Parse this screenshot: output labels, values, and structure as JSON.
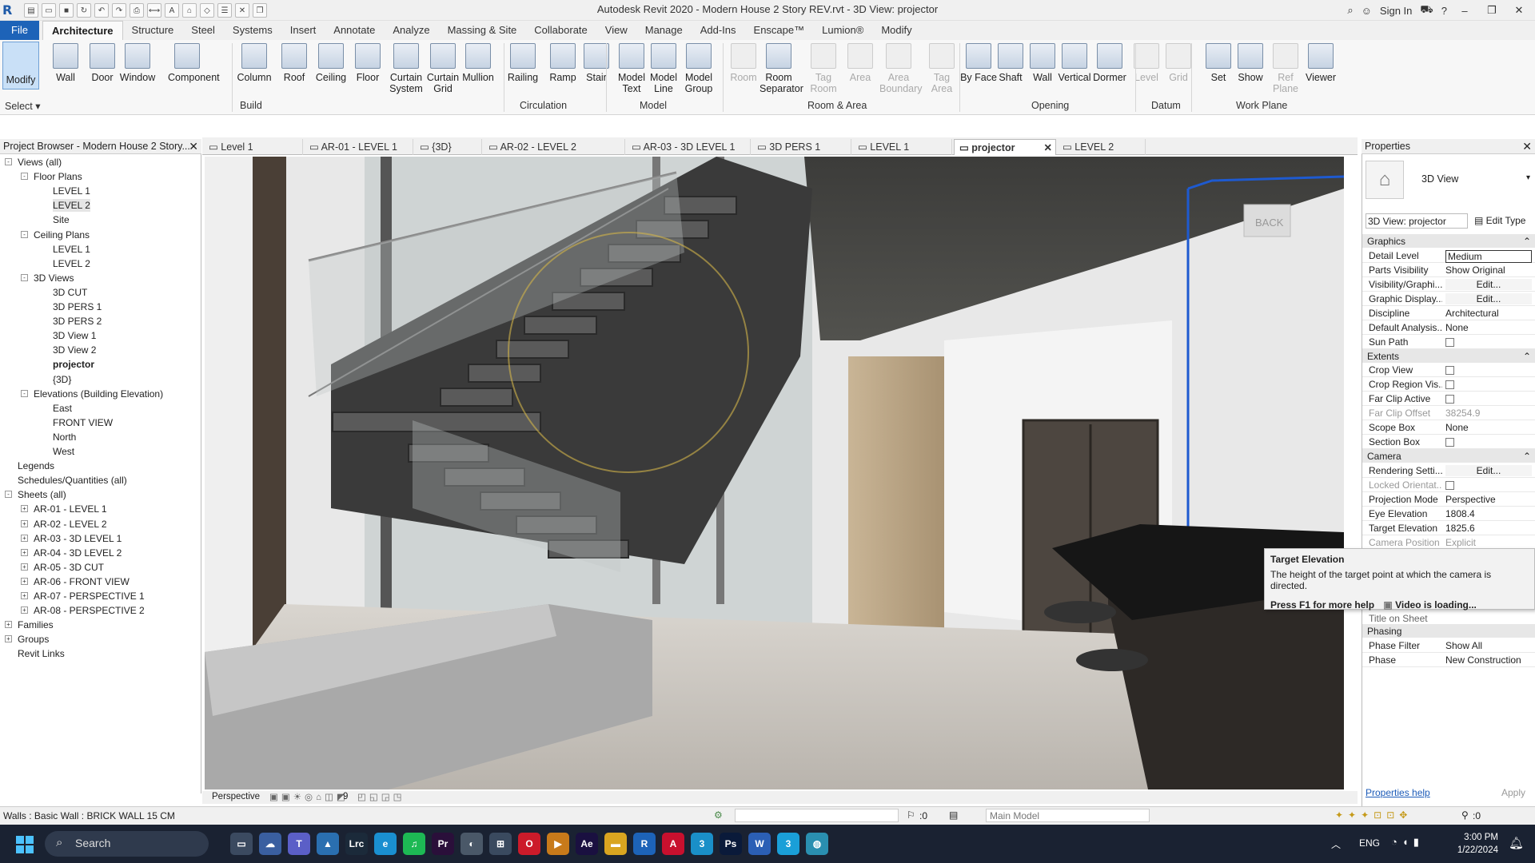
{
  "titlebar": {
    "title": "Autodesk Revit 2020 - Modern House 2 Story REV.rvt - 3D View: projector",
    "sign_in": "Sign In"
  },
  "ribbon_tabs": [
    "File",
    "Architecture",
    "Structure",
    "Steel",
    "Systems",
    "Insert",
    "Annotate",
    "Analyze",
    "Massing & Site",
    "Collaborate",
    "View",
    "Manage",
    "Add-Ins",
    "Enscape™",
    "Lumion®",
    "Modify"
  ],
  "active_tab": "Architecture",
  "ribbon": {
    "select_label": "Select",
    "modify": "Modify",
    "buttons": [
      {
        "label": "Wall",
        "disabled": false
      },
      {
        "label": "Door",
        "disabled": false
      },
      {
        "label": "Window",
        "disabled": false
      },
      {
        "label": "Component",
        "disabled": false
      },
      {
        "label": "Column",
        "disabled": false
      },
      {
        "label": "Roof",
        "disabled": false
      },
      {
        "label": "Ceiling",
        "disabled": false
      },
      {
        "label": "Floor",
        "disabled": false
      },
      {
        "label": "Curtain System",
        "disabled": false
      },
      {
        "label": "Curtain Grid",
        "disabled": false
      },
      {
        "label": "Mullion",
        "disabled": false
      },
      {
        "label": "Railing",
        "disabled": false
      },
      {
        "label": "Ramp",
        "disabled": false
      },
      {
        "label": "Stair",
        "disabled": false
      },
      {
        "label": "Model Text",
        "disabled": false
      },
      {
        "label": "Model Line",
        "disabled": false
      },
      {
        "label": "Model Group",
        "disabled": false
      },
      {
        "label": "Room",
        "disabled": true
      },
      {
        "label": "Room Separator",
        "disabled": false
      },
      {
        "label": "Tag Room",
        "disabled": true
      },
      {
        "label": "Area",
        "disabled": true
      },
      {
        "label": "Area Boundary",
        "disabled": true
      },
      {
        "label": "Tag Area",
        "disabled": true
      },
      {
        "label": "By Face",
        "disabled": false
      },
      {
        "label": "Shaft",
        "disabled": false
      },
      {
        "label": "Wall",
        "disabled": false
      },
      {
        "label": "Vertical",
        "disabled": false
      },
      {
        "label": "Dormer",
        "disabled": false
      },
      {
        "label": "Level",
        "disabled": true
      },
      {
        "label": "Grid",
        "disabled": true
      },
      {
        "label": "Set",
        "disabled": false
      },
      {
        "label": "Show",
        "disabled": false
      },
      {
        "label": "Ref Plane",
        "disabled": true
      },
      {
        "label": "Viewer",
        "disabled": false
      }
    ],
    "panels": [
      "Build",
      "Circulation",
      "Model",
      "Room & Area",
      "Opening",
      "Datum",
      "Work Plane"
    ]
  },
  "project_browser": {
    "title": "Project Browser - Modern House 2 Story...",
    "items": [
      {
        "label": "Views (all)",
        "level": 0,
        "toggle": "-"
      },
      {
        "label": "Floor Plans",
        "level": 1,
        "toggle": "-"
      },
      {
        "label": "LEVEL 1",
        "level": 2
      },
      {
        "label": "LEVEL 2",
        "level": 2,
        "highlight": true
      },
      {
        "label": "Site",
        "level": 2
      },
      {
        "label": "Ceiling Plans",
        "level": 1,
        "toggle": "-"
      },
      {
        "label": "LEVEL 1",
        "level": 2
      },
      {
        "label": "LEVEL 2",
        "level": 2
      },
      {
        "label": "3D Views",
        "level": 1,
        "toggle": "-"
      },
      {
        "label": "3D CUT",
        "level": 2
      },
      {
        "label": "3D PERS 1",
        "level": 2
      },
      {
        "label": "3D PERS 2",
        "level": 2
      },
      {
        "label": "3D View 1",
        "level": 2
      },
      {
        "label": "3D View 2",
        "level": 2
      },
      {
        "label": "projector",
        "level": 2,
        "bold": true
      },
      {
        "label": "{3D}",
        "level": 2
      },
      {
        "label": "Elevations (Building Elevation)",
        "level": 1,
        "toggle": "-"
      },
      {
        "label": "East",
        "level": 2
      },
      {
        "label": "FRONT VIEW",
        "level": 2
      },
      {
        "label": "North",
        "level": 2
      },
      {
        "label": "West",
        "level": 2
      },
      {
        "label": "Legends",
        "level": 0
      },
      {
        "label": "Schedules/Quantities (all)",
        "level": 0
      },
      {
        "label": "Sheets (all)",
        "level": 0,
        "toggle": "-"
      },
      {
        "label": "AR-01 - LEVEL 1",
        "level": 1,
        "toggle": "+"
      },
      {
        "label": "AR-02 - LEVEL 2",
        "level": 1,
        "toggle": "+"
      },
      {
        "label": "AR-03 - 3D LEVEL 1",
        "level": 1,
        "toggle": "+"
      },
      {
        "label": "AR-04 - 3D LEVEL 2",
        "level": 1,
        "toggle": "+"
      },
      {
        "label": "AR-05 - 3D CUT",
        "level": 1,
        "toggle": "+"
      },
      {
        "label": "AR-06 - FRONT VIEW",
        "level": 1,
        "toggle": "+"
      },
      {
        "label": "AR-07 - PERSPECTIVE 1",
        "level": 1,
        "toggle": "+"
      },
      {
        "label": "AR-08 - PERSPECTIVE 2",
        "level": 1,
        "toggle": "+"
      },
      {
        "label": "Families",
        "level": 0,
        "toggle": "+"
      },
      {
        "label": "Groups",
        "level": 0,
        "toggle": "+"
      },
      {
        "label": "Revit Links",
        "level": 0
      }
    ]
  },
  "view_tabs": [
    {
      "label": "Level 1"
    },
    {
      "label": "AR-01 - LEVEL 1"
    },
    {
      "label": "{3D}"
    },
    {
      "label": "AR-02 - LEVEL 2"
    },
    {
      "label": "AR-03 - 3D LEVEL 1"
    },
    {
      "label": "3D PERS 1"
    },
    {
      "label": "LEVEL 1"
    },
    {
      "label": "projector",
      "active": true
    },
    {
      "label": "LEVEL 2"
    }
  ],
  "viewport": {
    "back_label": "BACK",
    "view_mode": "Perspective",
    "scale_indicator": "9"
  },
  "properties": {
    "title": "Properties",
    "type_name": "3D View",
    "instance": "3D View: projector",
    "edit_type": "Edit Type",
    "groups": [
      {
        "name": "Graphics",
        "rows": [
          {
            "k": "Detail Level",
            "v": "Medium"
          },
          {
            "k": "Parts Visibility",
            "v": "Show Original"
          },
          {
            "k": "Visibility/Graphi...",
            "v": "Edit...",
            "btn": true
          },
          {
            "k": "Graphic Display...",
            "v": "Edit...",
            "btn": true
          },
          {
            "k": "Discipline",
            "v": "Architectural"
          },
          {
            "k": "Default Analysis...",
            "v": "None"
          },
          {
            "k": "Sun Path",
            "v": "",
            "checkbox": true
          }
        ]
      },
      {
        "name": "Extents",
        "rows": [
          {
            "k": "Crop View",
            "v": "",
            "checkbox": true
          },
          {
            "k": "Crop Region Vis...",
            "v": "",
            "checkbox": true
          },
          {
            "k": "Far Clip Active",
            "v": "",
            "checkbox": true
          },
          {
            "k": "Far Clip Offset",
            "v": "38254.9",
            "disabled": true
          },
          {
            "k": "Scope Box",
            "v": "None"
          },
          {
            "k": "Section Box",
            "v": "",
            "checkbox": true
          }
        ]
      },
      {
        "name": "Camera",
        "rows": [
          {
            "k": "Rendering Setti...",
            "v": "Edit...",
            "btn": true
          },
          {
            "k": "Locked Orientat...",
            "v": "",
            "checkbox": true,
            "disabled": true
          },
          {
            "k": "Projection Mode",
            "v": "Perspective"
          },
          {
            "k": "Eye Elevation",
            "v": "1808.4"
          },
          {
            "k": "Target Elevation",
            "v": "1825.6"
          },
          {
            "k": "Camera Position",
            "v": "Explicit",
            "disabled": true
          }
        ]
      }
    ],
    "hidden_row": "Title on Sheet",
    "phasing": {
      "name": "Phasing",
      "rows": [
        {
          "k": "Phase Filter",
          "v": "Show All"
        },
        {
          "k": "Phase",
          "v": "New Construction"
        }
      ]
    },
    "help_link": "Properties help",
    "apply": "Apply"
  },
  "tooltip": {
    "title": "Target Elevation",
    "text": "The height of the target point at which the camera is directed.",
    "f1": "Press F1 for more help",
    "video": "Video is loading..."
  },
  "status": {
    "left": "Walls : Basic Wall : BRICK WALL 15 CM",
    "zero": ":0",
    "model": "Main Model",
    "filter_count": ":0"
  },
  "taskbar": {
    "search": "Search",
    "lang": "ENG",
    "time": "3:00 PM",
    "date": "1/22/2024",
    "apps": [
      {
        "name": "file-explorer",
        "txt": "▭",
        "color": "#3b4a60"
      },
      {
        "name": "onedrive",
        "txt": "☁",
        "color": "#3a5fa0"
      },
      {
        "name": "teams",
        "txt": "T",
        "color": "#5b5fc7"
      },
      {
        "name": "photos",
        "txt": "▲",
        "color": "#2a6fb0"
      },
      {
        "name": "lightroom",
        "txt": "Lrc",
        "color": "#1b2a3a"
      },
      {
        "name": "edge",
        "txt": "e",
        "color": "#1a8fd0"
      },
      {
        "name": "spotify",
        "txt": "♫",
        "color": "#1db954"
      },
      {
        "name": "premiere",
        "txt": "Pr",
        "color": "#2a0f3a"
      },
      {
        "name": "app-sphere",
        "txt": "◐",
        "color": "#4a5868"
      },
      {
        "name": "calculator",
        "txt": "⊞",
        "color": "#3a4a5f"
      },
      {
        "name": "opera",
        "txt": "O",
        "color": "#cc1b2a"
      },
      {
        "name": "media-player",
        "txt": "▶",
        "color": "#c87a1a"
      },
      {
        "name": "after-effects",
        "txt": "Ae",
        "color": "#1a1040"
      },
      {
        "name": "folder",
        "txt": "▬",
        "color": "#d9a520"
      },
      {
        "name": "revit",
        "txt": "R",
        "color": "#1d63b8"
      },
      {
        "name": "autocad",
        "txt": "A",
        "color": "#c8102e"
      },
      {
        "name": "app-3",
        "txt": "3",
        "color": "#1a8fc8"
      },
      {
        "name": "photoshop",
        "txt": "Ps",
        "color": "#0a1a3a"
      },
      {
        "name": "word",
        "txt": "W",
        "color": "#2b5fb5"
      },
      {
        "name": "app-3b",
        "txt": "3",
        "color": "#1a9fd8"
      },
      {
        "name": "globe",
        "txt": "◍",
        "color": "#2a8fb0"
      }
    ]
  }
}
